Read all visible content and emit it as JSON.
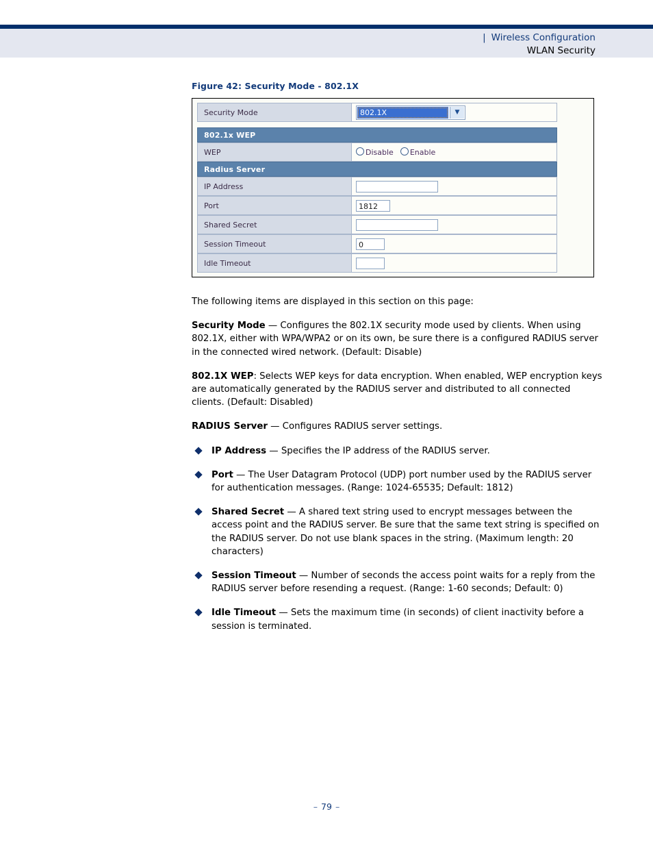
{
  "header": {
    "separator": "|",
    "breadcrumb": "Wireless Configuration",
    "subtitle": "WLAN Security"
  },
  "figure": {
    "caption": "Figure 42:  Security Mode - 802.1X",
    "rows": {
      "security_mode_label": "Security Mode",
      "security_mode_value": "802.1X",
      "wep_section": "802.1x WEP",
      "wep_label": "WEP",
      "wep_option_disable": "Disable",
      "wep_option_enable": "Enable",
      "radius_section": "Radius Server",
      "ip_address_label": "IP Address",
      "ip_address_value": "",
      "port_label": "Port",
      "port_value": "1812",
      "shared_secret_label": "Shared Secret",
      "shared_secret_value": "",
      "session_timeout_label": "Session Timeout",
      "session_timeout_value": "0",
      "idle_timeout_label": "Idle Timeout",
      "idle_timeout_value": ""
    },
    "icons": {
      "dropdown_arrow": "chevron-down-icon"
    }
  },
  "body": {
    "intro": "The following items are displayed in this section on this page:",
    "p1_term": "Security Mode",
    "p1_text": " — Configures the 802.1X security mode used by clients. When using 802.1X, either with WPA/WPA2 or on its own, be sure there is a configured RADIUS server in the connected wired network. (Default: Disable)",
    "p2_term": "802.1X WEP",
    "p2_text": ": Selects WEP keys for data encryption. When enabled, WEP encryption keys are automatically generated by the RADIUS server and distributed to all connected clients. (Default: Disabled)",
    "p3_term": "RADIUS Server",
    "p3_text": " — Configures RADIUS server settings.",
    "bullets": [
      {
        "term": "IP Address",
        "text": " — Specifies the IP address of the RADIUS server."
      },
      {
        "term": "Port",
        "text": " — The User Datagram Protocol (UDP) port number used by the RADIUS server for authentication messages. (Range: 1024-65535; Default: 1812)"
      },
      {
        "term": "Shared Secret",
        "text": " — A shared text string used to encrypt messages between the access point and the RADIUS server. Be sure that the same text string is specified on the RADIUS server. Do not use blank spaces in the string. (Maximum length: 20 characters)"
      },
      {
        "term": "Session Timeout",
        "text": " — Number of seconds the access point waits for a reply from the RADIUS server before resending a request. (Range: 1-60 seconds; Default: 0)"
      },
      {
        "term": "Idle Timeout",
        "text": " — Sets the maximum time (in seconds) of client inactivity before a session is terminated."
      }
    ]
  },
  "footer": {
    "dash_left": "–",
    "page_number": "79",
    "dash_right": "–"
  },
  "colors": {
    "navy_rule": "#012f6b",
    "header_band": "#e4e7f0",
    "heading_blue": "#123a7a",
    "section_header_blue": "#5b82ab",
    "label_cell": "#d5dbe6",
    "select_highlight": "#3a6fd0"
  }
}
